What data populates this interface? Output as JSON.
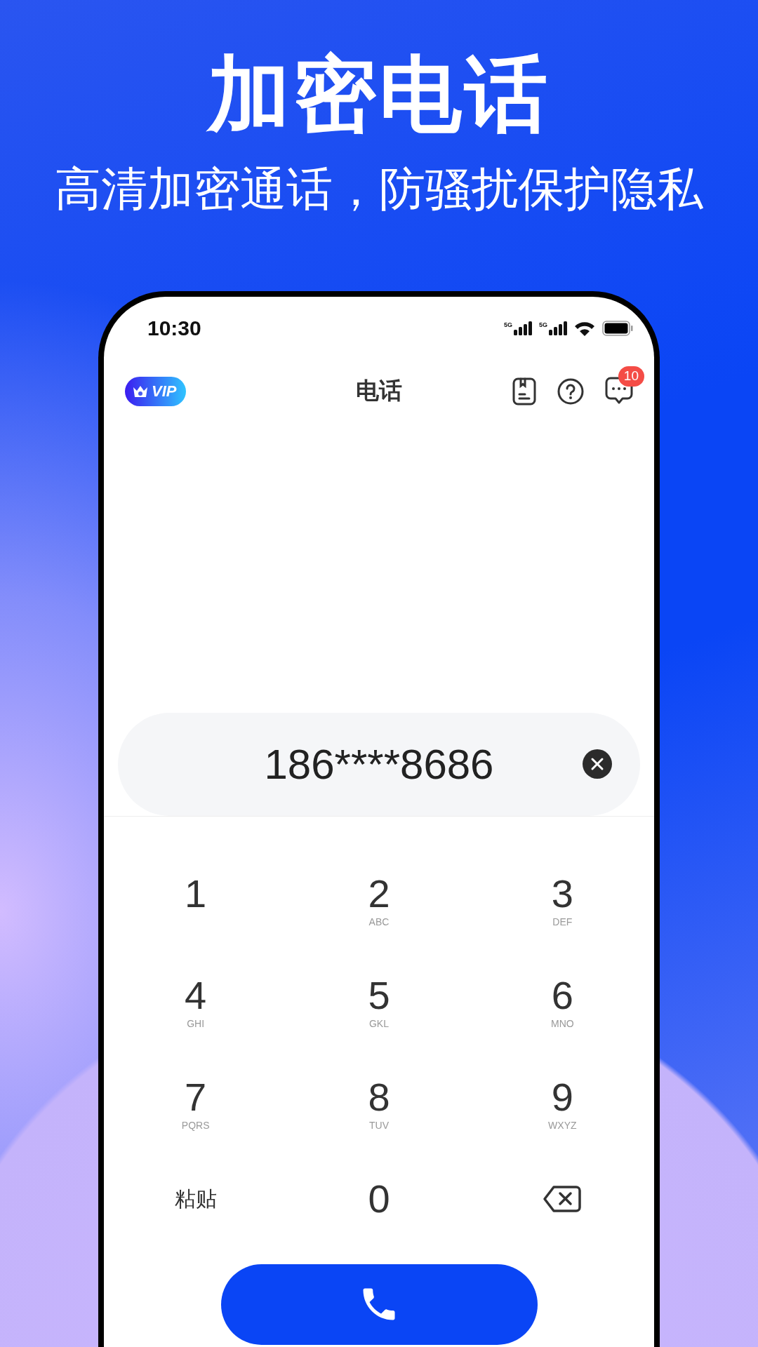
{
  "headline": "加密电话",
  "subtitle": "高清加密通话，防骚扰保护隐私",
  "status_bar": {
    "time": "10:30",
    "network_labels": [
      "5G",
      "5G"
    ]
  },
  "header": {
    "vip_label": "VIP",
    "title": "电话",
    "message_badge": "10"
  },
  "number_field": {
    "value": "186****8686"
  },
  "keypad": [
    {
      "kind": "digit",
      "digit": "1"
    },
    {
      "kind": "digit",
      "digit": "2",
      "letters": "ABC"
    },
    {
      "kind": "digit",
      "digit": "3",
      "letters": "DEF"
    },
    {
      "kind": "digit",
      "digit": "4",
      "letters": "GHI"
    },
    {
      "kind": "digit",
      "digit": "5",
      "letters": "GKL"
    },
    {
      "kind": "digit",
      "digit": "6",
      "letters": "MNO"
    },
    {
      "kind": "digit",
      "digit": "7",
      "letters": "PQRS"
    },
    {
      "kind": "digit",
      "digit": "8",
      "letters": "TUV"
    },
    {
      "kind": "digit",
      "digit": "9",
      "letters": "WXYZ"
    },
    {
      "kind": "paste",
      "label": "粘贴"
    },
    {
      "kind": "digit",
      "digit": "0"
    },
    {
      "kind": "backspace"
    }
  ]
}
